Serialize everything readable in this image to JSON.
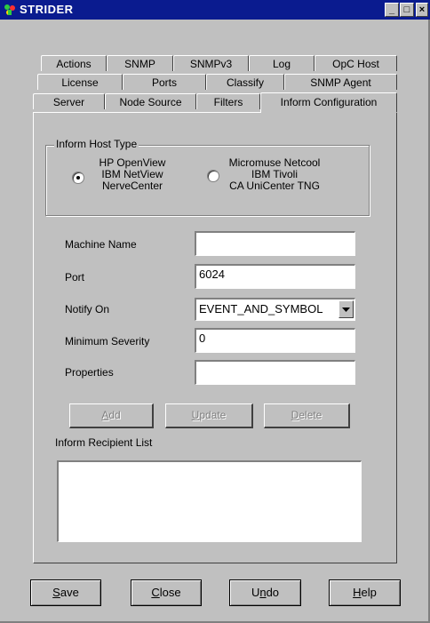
{
  "window": {
    "title": "STRIDER"
  },
  "title_buttons": {
    "minimize": "_",
    "maximize": "□",
    "close": "×"
  },
  "tabs": {
    "row1": [
      "Actions",
      "SNMP",
      "SNMPv3",
      "Log",
      "OpC Host"
    ],
    "row2": [
      "License",
      "Ports",
      "Classify",
      "SNMP Agent"
    ],
    "row3": [
      "Server",
      "Node Source",
      "Filters",
      "Inform Configuration"
    ],
    "active": "Inform Configuration"
  },
  "inform_host_type": {
    "legend": "Inform Host Type",
    "option1_lines": [
      "HP OpenView",
      "IBM NetView",
      "NerveCenter"
    ],
    "option2_lines": [
      "Micromuse Netcool",
      "IBM Tivoli",
      "CA UniCenter TNG"
    ],
    "selected": "option1"
  },
  "form": {
    "machine_name_label": "Machine Name",
    "machine_name_value": "",
    "port_label": "Port",
    "port_value": "6024",
    "notify_on_label": "Notify On",
    "notify_on_value": "EVENT_AND_SYMBOL",
    "min_severity_label": "Minimum Severity",
    "min_severity_value": "0",
    "properties_label": "Properties",
    "properties_value": ""
  },
  "actions": {
    "add_rest": "dd",
    "update_rest": "pdate",
    "delete_rest": "elete",
    "add_u": "A",
    "update_u": "U",
    "delete_u": "D"
  },
  "recipient_list_label": "Inform Recipient List",
  "bottom": {
    "save_u": "S",
    "save_rest": "ave",
    "close_u": "C",
    "close_rest": "lose",
    "undo_pre": "U",
    "undo_u": "n",
    "undo_rest": "do",
    "help_u": "H",
    "help_rest": "elp"
  }
}
